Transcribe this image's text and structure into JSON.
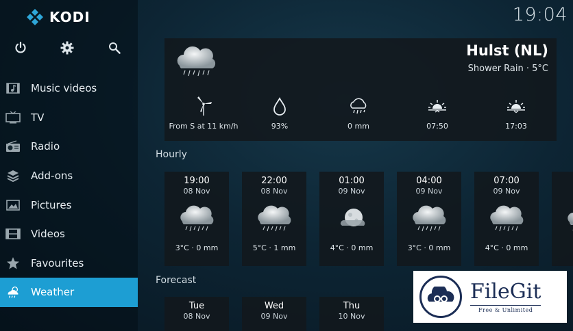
{
  "app": {
    "name": "KODI"
  },
  "clock": "19:04",
  "top_icons": [
    "power-icon",
    "gear-icon",
    "search-icon"
  ],
  "sidebar": {
    "items": [
      {
        "label": "Music videos",
        "icon": "music-video-icon"
      },
      {
        "label": "TV",
        "icon": "tv-icon"
      },
      {
        "label": "Radio",
        "icon": "radio-icon"
      },
      {
        "label": "Add-ons",
        "icon": "addons-icon"
      },
      {
        "label": "Pictures",
        "icon": "pictures-icon"
      },
      {
        "label": "Videos",
        "icon": "videos-icon"
      },
      {
        "label": "Favourites",
        "icon": "star-icon"
      },
      {
        "label": "Weather",
        "icon": "weather-icon",
        "active": true
      }
    ]
  },
  "current": {
    "city": "Hulst (NL)",
    "condition": "Shower Rain · 5°C",
    "stats": [
      {
        "icon": "wind-icon",
        "value": "From S at 11 km/h"
      },
      {
        "icon": "humidity-icon",
        "value": "93%"
      },
      {
        "icon": "precipitation-icon",
        "value": "0 mm"
      },
      {
        "icon": "sunrise-icon",
        "value": "07:50"
      },
      {
        "icon": "sunset-icon",
        "value": "17:03"
      }
    ]
  },
  "hourly": {
    "label": "Hourly",
    "items": [
      {
        "time": "19:00",
        "date": "08 Nov",
        "value": "3°C · 0 mm",
        "icon": "cloud-rain-icon"
      },
      {
        "time": "22:00",
        "date": "08 Nov",
        "value": "5°C · 1 mm",
        "icon": "cloud-rain-icon"
      },
      {
        "time": "01:00",
        "date": "09 Nov",
        "value": "4°C · 0 mm",
        "icon": "moon-cloud-icon"
      },
      {
        "time": "04:00",
        "date": "09 Nov",
        "value": "3°C · 0 mm",
        "icon": "cloud-rain-icon"
      },
      {
        "time": "07:00",
        "date": "09 Nov",
        "value": "4°C · 0 mm",
        "icon": "cloud-rain-icon"
      }
    ]
  },
  "forecast": {
    "label": "Forecast",
    "items": [
      {
        "day": "Tue",
        "date": "08 Nov"
      },
      {
        "day": "Wed",
        "date": "09 Nov"
      },
      {
        "day": "Thu",
        "date": "10 Nov"
      }
    ]
  },
  "watermark": {
    "name": "FileGit",
    "tagline": "Free & Unlimited"
  },
  "colors": {
    "accent": "#1d9ed3",
    "panel": "#12181c",
    "watermark": "#1b2d55"
  }
}
